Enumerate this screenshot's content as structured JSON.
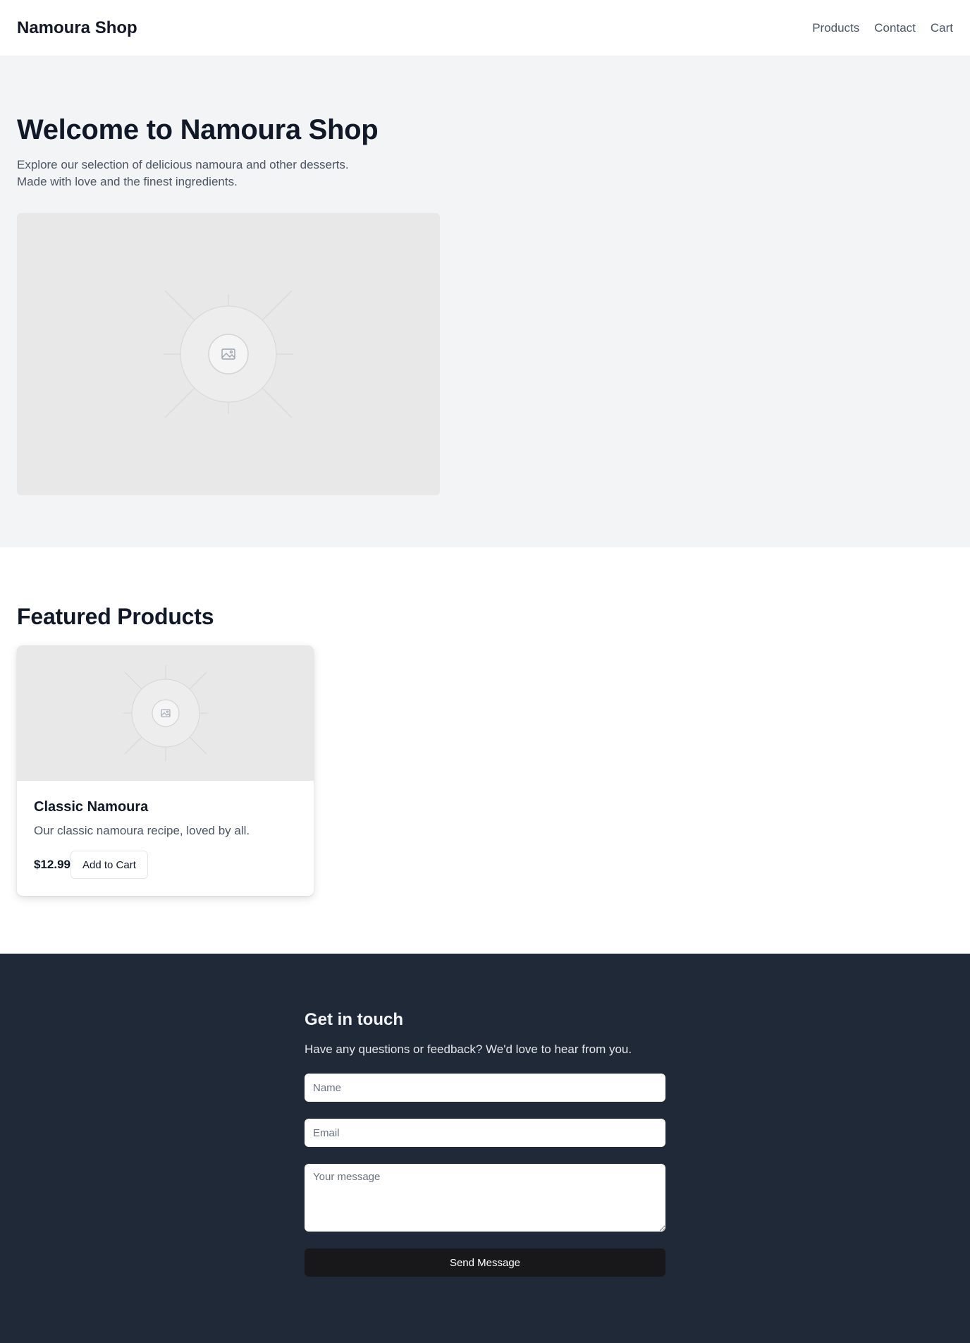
{
  "header": {
    "brand": "Namoura Shop",
    "nav": [
      "Products",
      "Contact",
      "Cart"
    ]
  },
  "hero": {
    "title": "Welcome to Namoura Shop",
    "line1": "Explore our selection of delicious namoura and other desserts.",
    "line2": "Made with love and the finest ingredients.",
    "image_icon": "image-placeholder-icon"
  },
  "featured": {
    "title": "Featured Products",
    "products": [
      {
        "name": "Classic Namoura",
        "description": "Our classic namoura recipe, loved by all.",
        "price": "$12.99",
        "button": "Add to Cart",
        "image_icon": "image-placeholder-icon"
      }
    ]
  },
  "contact": {
    "title": "Get in touch",
    "subtitle": "Have any questions or feedback? We'd love to hear from you.",
    "name_placeholder": "Name",
    "email_placeholder": "Email",
    "message_placeholder": "Your message",
    "submit": "Send Message"
  },
  "colors": {
    "page_text": "#111827",
    "muted_text": "#4b5563",
    "hero_bg": "#f3f4f6",
    "contact_bg": "#1f2937",
    "send_button_bg": "#18181b"
  }
}
